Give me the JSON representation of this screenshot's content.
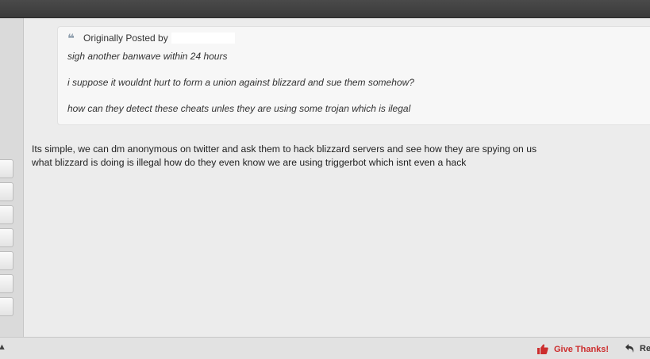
{
  "quote": {
    "header_label": "Originally Posted by",
    "lines": [
      "sigh another banwave within 24 hours",
      "i suppose it wouldnt hurt to form a union against blizzard and sue them somehow?",
      "how can they detect these cheats unles they are using some trojan which is ilegal"
    ]
  },
  "post": {
    "lines": [
      "Its simple, we can dm anonymous on twitter and ask them to hack blizzard servers and see how they are spying on us",
      "what blizzard is doing is illegal how do they even know we are using triggerbot which isnt even a hack"
    ]
  },
  "footer": {
    "thanks_label": "Give Thanks!",
    "reply_label": "Re"
  },
  "colors": {
    "thanks": "#cc2d2d",
    "quote_icon": "#8f9fae"
  }
}
